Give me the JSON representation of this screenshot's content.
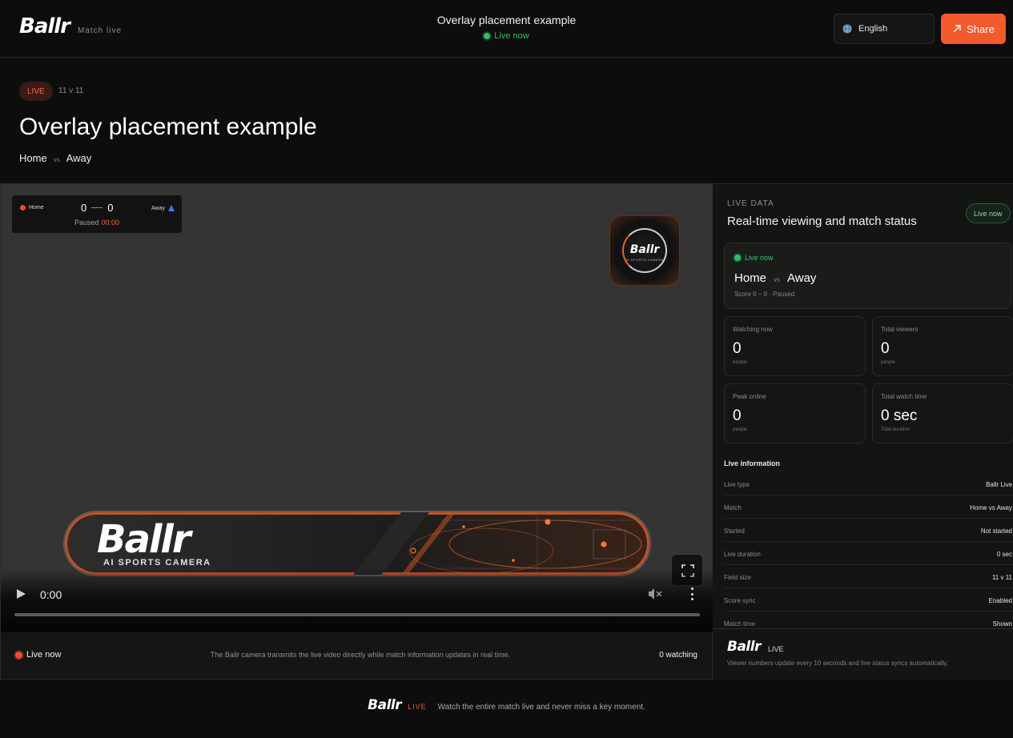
{
  "brand": {
    "logo": "Ballr",
    "subtitle": "Match live"
  },
  "topbar": {
    "title": "Overlay placement example",
    "status": "Live now",
    "language": "English",
    "share_label": "Share"
  },
  "header": {
    "badge": "LIVE",
    "format": "11 v 11",
    "title": "Overlay placement example",
    "home": "Home",
    "vs": "vs",
    "away": "Away"
  },
  "scoreboard": {
    "home": "Home",
    "away": "Away",
    "home_score": "0",
    "away_score": "0",
    "state": "Paused",
    "clock": "00:00",
    "home_color": "#ef4a37",
    "away_color": "#3b7cf0"
  },
  "corner_logo": {
    "text": "Ballr",
    "subtext": "AI SPORTS CAMERA"
  },
  "banner": {
    "logo": "Ballr",
    "subtext": "AI SPORTS CAMERA"
  },
  "player": {
    "time": "0:00",
    "progress": 0,
    "icons": [
      "play-icon",
      "mute-icon",
      "kebab-icon",
      "fullscreen-icon"
    ]
  },
  "video_footer": {
    "status": "Live now",
    "description": "The Ballr camera transmits the live video directly while match information updates in real time.",
    "watching": "0 watching"
  },
  "panel": {
    "eyebrow": "LIVE DATA",
    "heading": "Real-time viewing and match status",
    "pill": "Live now",
    "match_card": {
      "status": "Live now",
      "home": "Home",
      "vs": "vs",
      "away": "Away",
      "meta": "Score 0 – 0 · Paused"
    },
    "stats": [
      {
        "label": "Watching now",
        "value": "0",
        "unit": "people"
      },
      {
        "label": "Total viewers",
        "value": "0",
        "unit": "people"
      },
      {
        "label": "Peak online",
        "value": "0",
        "unit": "people"
      },
      {
        "label": "Total watch time",
        "value": "0 sec",
        "unit": "Total duration"
      }
    ],
    "info_title": "Live information",
    "info": [
      {
        "key": "Live type",
        "value": "Ballr Live"
      },
      {
        "key": "Match",
        "value": "Home vs Away"
      },
      {
        "key": "Started",
        "value": "Not started"
      },
      {
        "key": "Live duration",
        "value": "0 sec"
      },
      {
        "key": "Field size",
        "value": "11 v 11"
      },
      {
        "key": "Score sync",
        "value": "Enabled"
      },
      {
        "key": "Match time",
        "value": "Shown"
      }
    ],
    "foot_logo": "Ballr",
    "foot_live": "LIVE",
    "foot_desc": "Viewer numbers update every 10 seconds and live status syncs automatically."
  },
  "footer": {
    "logo": "Ballr",
    "live": "LIVE",
    "text": "Watch the entire match live and never miss a key moment."
  },
  "colors": {
    "accent": "#f35a2c",
    "live_green": "#2fbf6a",
    "live_red": "#ef4a37",
    "background": "#0c0d0c"
  }
}
